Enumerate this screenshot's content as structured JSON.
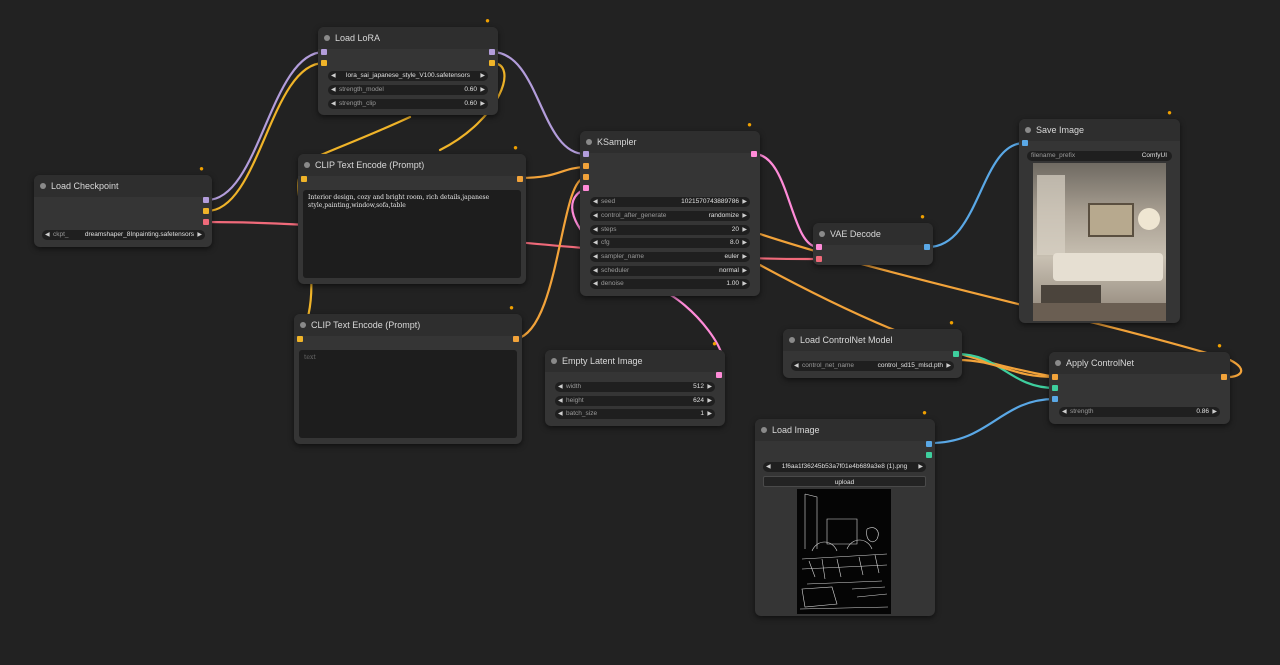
{
  "colors": {
    "clip": "#f0b429",
    "model": "#b39ddb",
    "vae": "#f06a7a",
    "latent": "#ff8bd8",
    "image": "#5aa8e6",
    "control_net": "#3ecf9e",
    "conditioning": "#f2a33a",
    "background": "#222222",
    "node_body": "#353535"
  },
  "nodes": {
    "load_checkpoint": {
      "title": "Load Checkpoint",
      "ckpt_label": "ckpt_",
      "ckpt_value": "dreamshaper_8Inpainting.safetensors"
    },
    "load_lora": {
      "title": "Load LoRA",
      "lora_value": "lora_sai_japanese_style_V100.safetensors",
      "strength_model_label": "strength_model",
      "strength_model_value": "0.60",
      "strength_clip_label": "strength_clip",
      "strength_clip_value": "0.60"
    },
    "clip_text_encode_pos": {
      "title": "CLIP Text Encode (Prompt)",
      "text": "Interior design, cozy and bright room, rich details,japanese style,painting,window,sofa,table"
    },
    "clip_text_encode_neg": {
      "title": "CLIP Text Encode (Prompt)",
      "placeholder": "text"
    },
    "ksampler": {
      "title": "KSampler",
      "fields": [
        {
          "label": "seed",
          "value": "1021570743889786"
        },
        {
          "label": "control_after_generate",
          "value": "randomize"
        },
        {
          "label": "steps",
          "value": "20"
        },
        {
          "label": "cfg",
          "value": "8.0"
        },
        {
          "label": "sampler_name",
          "value": "euler"
        },
        {
          "label": "scheduler",
          "value": "normal"
        },
        {
          "label": "denoise",
          "value": "1.00"
        }
      ]
    },
    "empty_latent": {
      "title": "Empty Latent Image",
      "fields": [
        {
          "label": "width",
          "value": "512"
        },
        {
          "label": "height",
          "value": "624"
        },
        {
          "label": "batch_size",
          "value": "1"
        }
      ]
    },
    "vae_decode": {
      "title": "VAE Decode"
    },
    "save_image": {
      "title": "Save Image",
      "filename_prefix_label": "filename_prefix",
      "filename_prefix_value": "ComfyUI"
    },
    "load_controlnet": {
      "title": "Load ControlNet Model",
      "control_net_name_label": "control_net_name",
      "control_net_name_value": "control_sd15_mlsd.pth"
    },
    "apply_controlnet": {
      "title": "Apply ControlNet",
      "strength_label": "strength",
      "strength_value": "0.86"
    },
    "load_image": {
      "title": "Load Image",
      "image_value": "1f6aa1f36245b53a7f01e4b689a3e8 (1).png",
      "upload_label": "upload"
    }
  },
  "icons": {
    "node_badge": "fox-icon",
    "arrow_left": "triangle-left-icon",
    "arrow_right": "triangle-right-icon"
  }
}
